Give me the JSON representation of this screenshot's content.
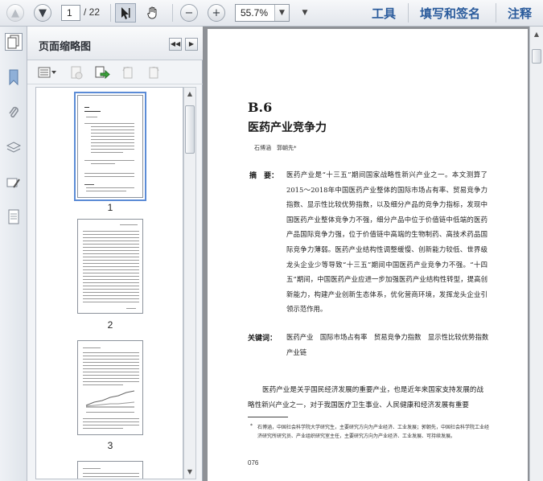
{
  "toolbar": {
    "current_page": "1",
    "page_total": "/ 22",
    "zoom": "55.7%",
    "tools_label": "工具",
    "sign_label": "填写和签名",
    "comment_label": "注释"
  },
  "panel": {
    "title": "页面缩略图",
    "thumbnails": [
      {
        "label": "1"
      },
      {
        "label": "2"
      },
      {
        "label": "3"
      }
    ]
  },
  "document": {
    "section": "B.6",
    "title": "医药产业竞争力",
    "authors": "石博涵　郭朝先*",
    "abstract_label": "摘　要：",
    "abstract": "医药产业是“十三五”期间国家战略性新兴产业之一。本文测算了2015～2018年中国医药产业整体的国际市场占有率、贸易竞争力指数、显示性比较优势指数，以及细分产品的竞争力指标，发现中国医药产业整体竞争力不强，细分产品中位于价值链中低端的医药产品国际竞争力强，位于价值链中高端的生物制药、高技术药品国际竞争力薄弱。医药产业结构性调整缓慢、创新能力较低、世界级龙头企业少等导致“十三五”期间中国医药产业竞争力不强。“十四五”期间，中国医药产业应进一步加强医药产业结构性转型，提高创新能力，构建产业创新生态体系，优化营商环境，发挥龙头企业引领示范作用。",
    "keywords_label": "关键词：",
    "keywords": "医药产业　国际市场占有率　贸易竞争力指数　显示性比较优势指数　产业链",
    "body": "医药产业是关乎国民经济发展的重要产业，也是近年来国家支持发展的战略性新兴产业之一，对于我国医疗卫生事业、人民健康和经济发展有重要",
    "footnote_mark": "*",
    "footnote": "石博涵，中国社会科学院大学研究生，主要研究方向为产业经济、工业发展；郭朝先，中国社会科学院工业经济研究所研究员、产业组织研究室主任，主要研究方向为产业经济、工业发展、可持续发展。",
    "page_number": "076"
  }
}
